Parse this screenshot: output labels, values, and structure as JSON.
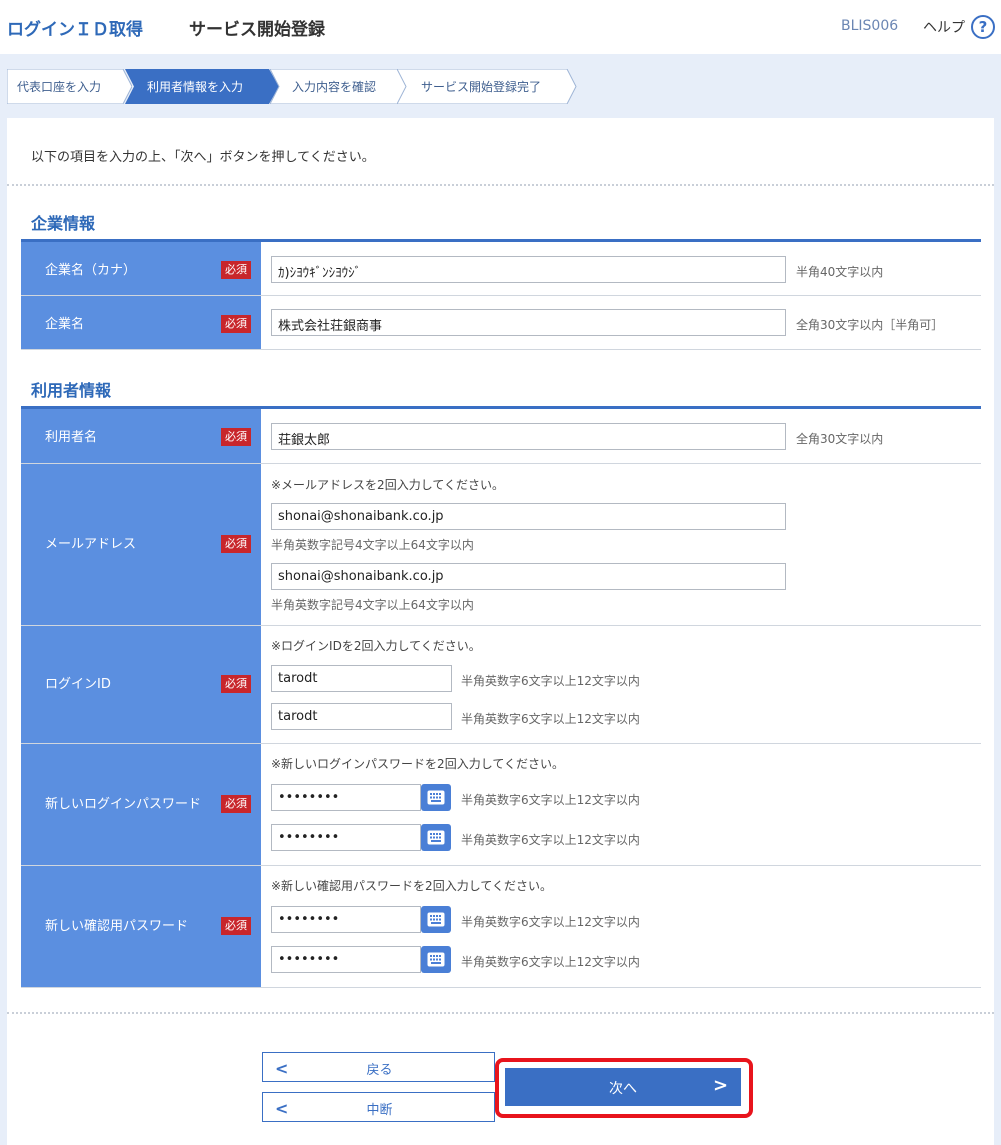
{
  "header": {
    "title_left": "ログインＩＤ取得",
    "title_main": "サービス開始登録",
    "screen_code": "BLIS006",
    "help_label": "ヘルプ",
    "help_icon": "?"
  },
  "steps": [
    {
      "label": "代表口座を入力",
      "active": false
    },
    {
      "label": "利用者情報を入力",
      "active": true
    },
    {
      "label": "入力内容を確認",
      "active": false
    },
    {
      "label": "サービス開始登録完了",
      "active": false
    }
  ],
  "intro": "以下の項目を入力の上、「次へ」ボタンを押してください。",
  "required_label": "必須",
  "company": {
    "title": "企業情報",
    "kana_label": "企業名（カナ）",
    "kana_value": "ｶ)ｼﾖｳｷﾞﾝｼﾖｳｼﾞ",
    "kana_hint": "半角40文字以内",
    "name_label": "企業名",
    "name_value": "株式会社荘銀商事",
    "name_hint": "全角30文字以内［半角可］"
  },
  "user": {
    "title": "利用者情報",
    "username_label": "利用者名",
    "username_value": "荘銀太郎",
    "username_hint": "全角30文字以内",
    "email_label": "メールアドレス",
    "email_note": "※メールアドレスを2回入力してください。",
    "email_value1": "shonai@shonaibank.co.jp",
    "email_value2": "shonai@shonaibank.co.jp",
    "email_hint": "半角英数字記号4文字以上64文字以内",
    "login_label": "ログインID",
    "login_note": "※ログインIDを2回入力してください。",
    "login_value1": "tarodt",
    "login_value2": "tarodt",
    "login_hint": "半角英数字6文字以上12文字以内",
    "pw_label": "新しいログインパスワード",
    "pw_note": "※新しいログインパスワードを2回入力してください。",
    "pw_value1": "••••••••",
    "pw_value2": "••••••••",
    "pw_hint": "半角英数字6文字以上12文字以内",
    "cpw_label": "新しい確認用パスワード",
    "cpw_note": "※新しい確認用パスワードを2回入力してください。",
    "cpw_value1": "••••••••",
    "cpw_value2": "••••••••",
    "cpw_hint": "半角英数字6文字以上12文字以内"
  },
  "buttons": {
    "back": "戻る",
    "suspend": "中断",
    "next": "次へ"
  },
  "colors": {
    "accent": "#3a6fc4",
    "label_bg": "#5b8fe0",
    "required": "#c8262b",
    "highlight": "#e8141c"
  }
}
